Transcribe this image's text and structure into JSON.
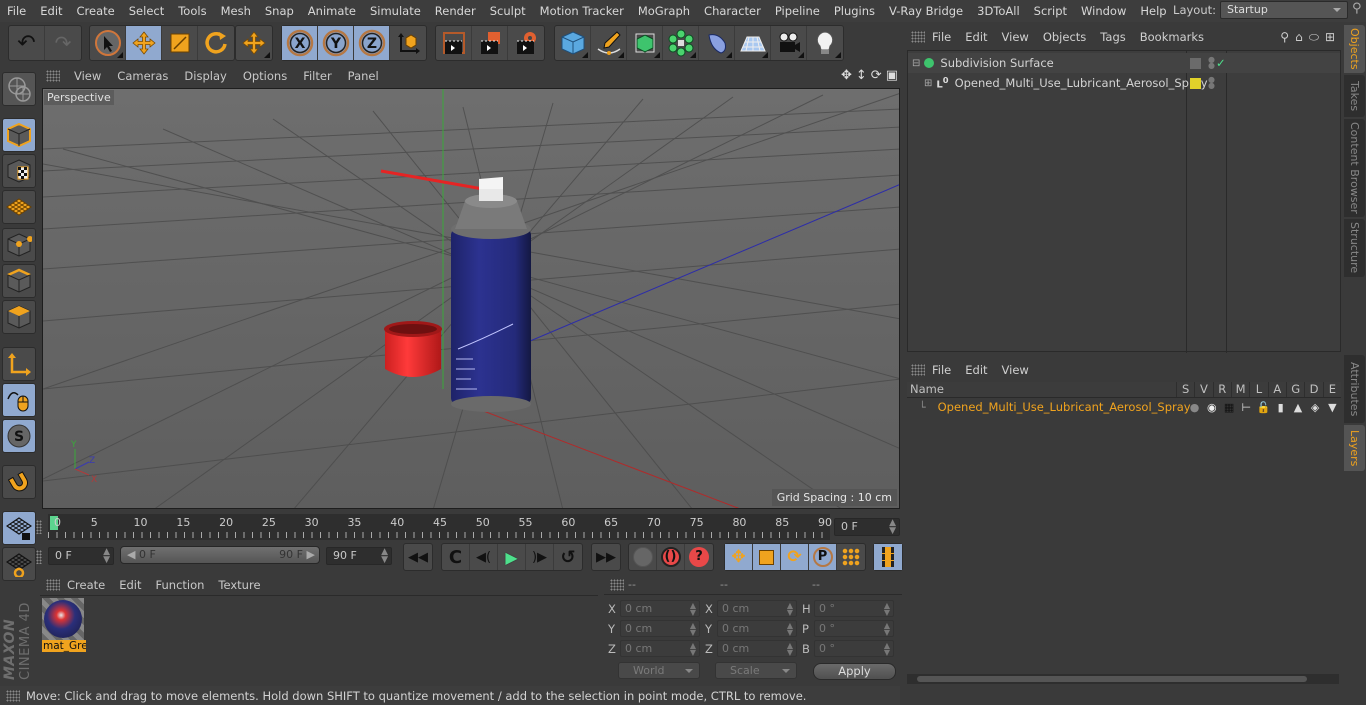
{
  "menubar": {
    "items": [
      "File",
      "Edit",
      "Create",
      "Select",
      "Tools",
      "Mesh",
      "Snap",
      "Animate",
      "Simulate",
      "Render",
      "Sculpt",
      "Motion Tracker",
      "MoGraph",
      "Character",
      "Pipeline",
      "Plugins",
      "V-Ray Bridge",
      "3DToAll",
      "Script",
      "Window",
      "Help"
    ],
    "layout_label": "Layout:",
    "layout_value": "Startup"
  },
  "toolbar": {
    "groups": [
      [
        "undo-icon",
        "redo-icon"
      ],
      [
        "live-selection-icon",
        "move-icon",
        "scale-icon",
        "rotate-icon"
      ],
      [
        "recent-tool-icon"
      ],
      [
        "x-axis-lock-icon",
        "y-axis-lock-icon",
        "z-axis-lock-icon",
        "coordinate-system-icon"
      ],
      [
        "render-view-icon",
        "render-to-picture-viewer-icon",
        "render-settings-icon"
      ],
      [
        "cube-icon",
        "pen-icon",
        "subdivision-surface-icon",
        "cloner-icon",
        "deformer-icon",
        "floor-icon",
        "camera-icon",
        "light-icon"
      ]
    ],
    "axis_labels": [
      "X",
      "Y",
      "Z"
    ]
  },
  "viewport": {
    "menu": [
      "View",
      "Cameras",
      "Display",
      "Options",
      "Filter",
      "Panel"
    ],
    "label": "Perspective",
    "grid_spacing": "Grid Spacing : 10 cm",
    "axis_gizmo": {
      "x": "X",
      "y": "Y",
      "z": "Z"
    }
  },
  "leftbar": {
    "tools": [
      "make-editable-icon",
      "model-mode-icon",
      "texture-mode-icon",
      "workplane-mode-icon",
      "points-mode-icon",
      "edges-mode-icon",
      "polygons-mode-icon",
      "axis-mode-icon",
      "tweak-mode-icon",
      "snap-icon",
      "magnet-icon",
      "locked-workplane-icon",
      "planar-workplane-icon"
    ]
  },
  "timeline": {
    "ticks": [
      "0",
      "5",
      "10",
      "15",
      "20",
      "25",
      "30",
      "35",
      "40",
      "45",
      "50",
      "55",
      "60",
      "65",
      "70",
      "75",
      "80",
      "85",
      "90"
    ],
    "current_frame": "0 F",
    "start_field": "0 F",
    "range_start": "0 F",
    "range_end": "90 F",
    "end_field": "90 F"
  },
  "materials": {
    "menu": [
      "Create",
      "Edit",
      "Function",
      "Texture"
    ],
    "items": [
      {
        "name": "mat_Gre"
      }
    ]
  },
  "coordinates": {
    "headers": [
      "--",
      "--",
      "--"
    ],
    "rows": [
      {
        "a": "X",
        "av": "0 cm",
        "b": "X",
        "bv": "0 cm",
        "c": "H",
        "cv": "0 °"
      },
      {
        "a": "Y",
        "av": "0 cm",
        "b": "Y",
        "bv": "0 cm",
        "c": "P",
        "cv": "0 °"
      },
      {
        "a": "Z",
        "av": "0 cm",
        "b": "Z",
        "bv": "0 cm",
        "c": "B",
        "cv": "0 °"
      }
    ],
    "space": "World",
    "mode": "Scale",
    "apply": "Apply"
  },
  "objects": {
    "menu": [
      "File",
      "Edit",
      "View",
      "Objects",
      "Tags",
      "Bookmarks"
    ],
    "items": [
      {
        "name": "Subdivision Surface",
        "color": "#6b6b6b"
      },
      {
        "name": "Opened_Multi_Use_Lubricant_Aerosol_Spray",
        "color": "#e1d22a"
      }
    ]
  },
  "layers": {
    "menu": [
      "File",
      "Edit",
      "View"
    ],
    "columns": [
      "Name",
      "S",
      "V",
      "R",
      "M",
      "L",
      "A",
      "G",
      "D",
      "E"
    ],
    "items": [
      {
        "name": "Opened_Multi_Use_Lubricant_Aerosol_Spray",
        "color": "#e1d22a"
      }
    ]
  },
  "sidetabs": {
    "top": [
      "Objects",
      "Takes",
      "Content Browser",
      "Structure"
    ],
    "bottom": [
      "Attributes",
      "Layers"
    ]
  },
  "status": "Move: Click and drag to move elements. Hold down SHIFT to quantize movement / add to the selection in point mode, CTRL to remove.",
  "brand": {
    "maker": "MAXON",
    "product": "CINEMA 4D"
  },
  "colors": {
    "accent": "#f0a31e",
    "active_button": "#90a9cf",
    "playhead": "#5cd48e"
  }
}
